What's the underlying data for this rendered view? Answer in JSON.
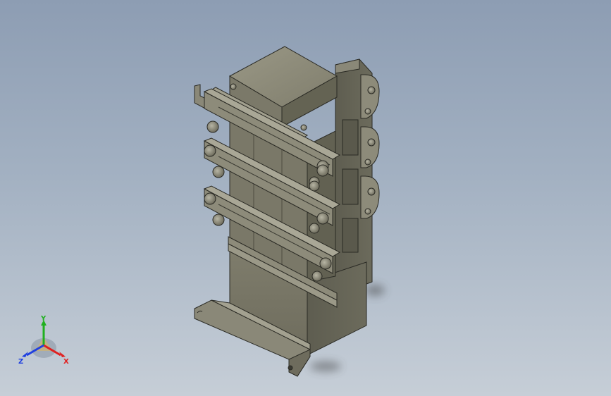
{
  "viewport": {
    "background_top": "#8d9db3",
    "background_bottom": "#c6ced7",
    "model_color": "#7c7a6a",
    "model_face_top": "#8e8c7c",
    "model_face_side": "#5c5b4e"
  },
  "triad": {
    "x_label": "X",
    "y_label": "Y",
    "z_label": "Z",
    "x_color": "#e02020",
    "y_color": "#20b020",
    "z_color": "#2040e0"
  }
}
